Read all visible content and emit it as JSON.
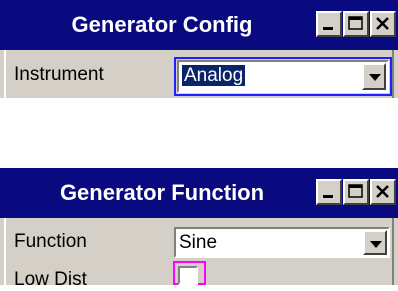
{
  "windows": [
    {
      "title": "Generator Config",
      "rows": [
        {
          "label": "Instrument",
          "value": "Analog"
        }
      ]
    },
    {
      "title": "Generator Function",
      "rows": [
        {
          "label": "Function",
          "value": "Sine"
        },
        {
          "label": "Low Dist",
          "checked": false
        }
      ]
    }
  ],
  "colors": {
    "titlebar": "#0a0a80",
    "panel": "#d4d0c8",
    "focus_ring": "#2020ff",
    "checkbox_highlight": "#ff00ff"
  }
}
